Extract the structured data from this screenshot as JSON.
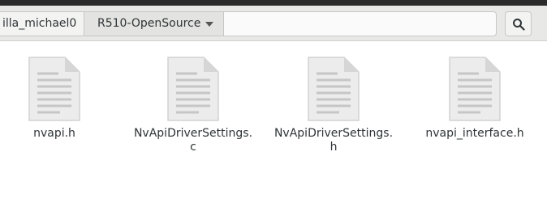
{
  "breadcrumbs": [
    {
      "label": "illa_michael0"
    },
    {
      "label": "R510-OpenSource"
    }
  ],
  "icons": {
    "dropdown": "chevron-down-icon",
    "search": "search-icon",
    "file": "text-document-icon"
  },
  "files": [
    {
      "name": "nvapi.h"
    },
    {
      "name": "NvApiDriverSettings.\nc"
    },
    {
      "name": "NvApiDriverSettings.\nh"
    },
    {
      "name": "nvapi_interface.h"
    }
  ]
}
